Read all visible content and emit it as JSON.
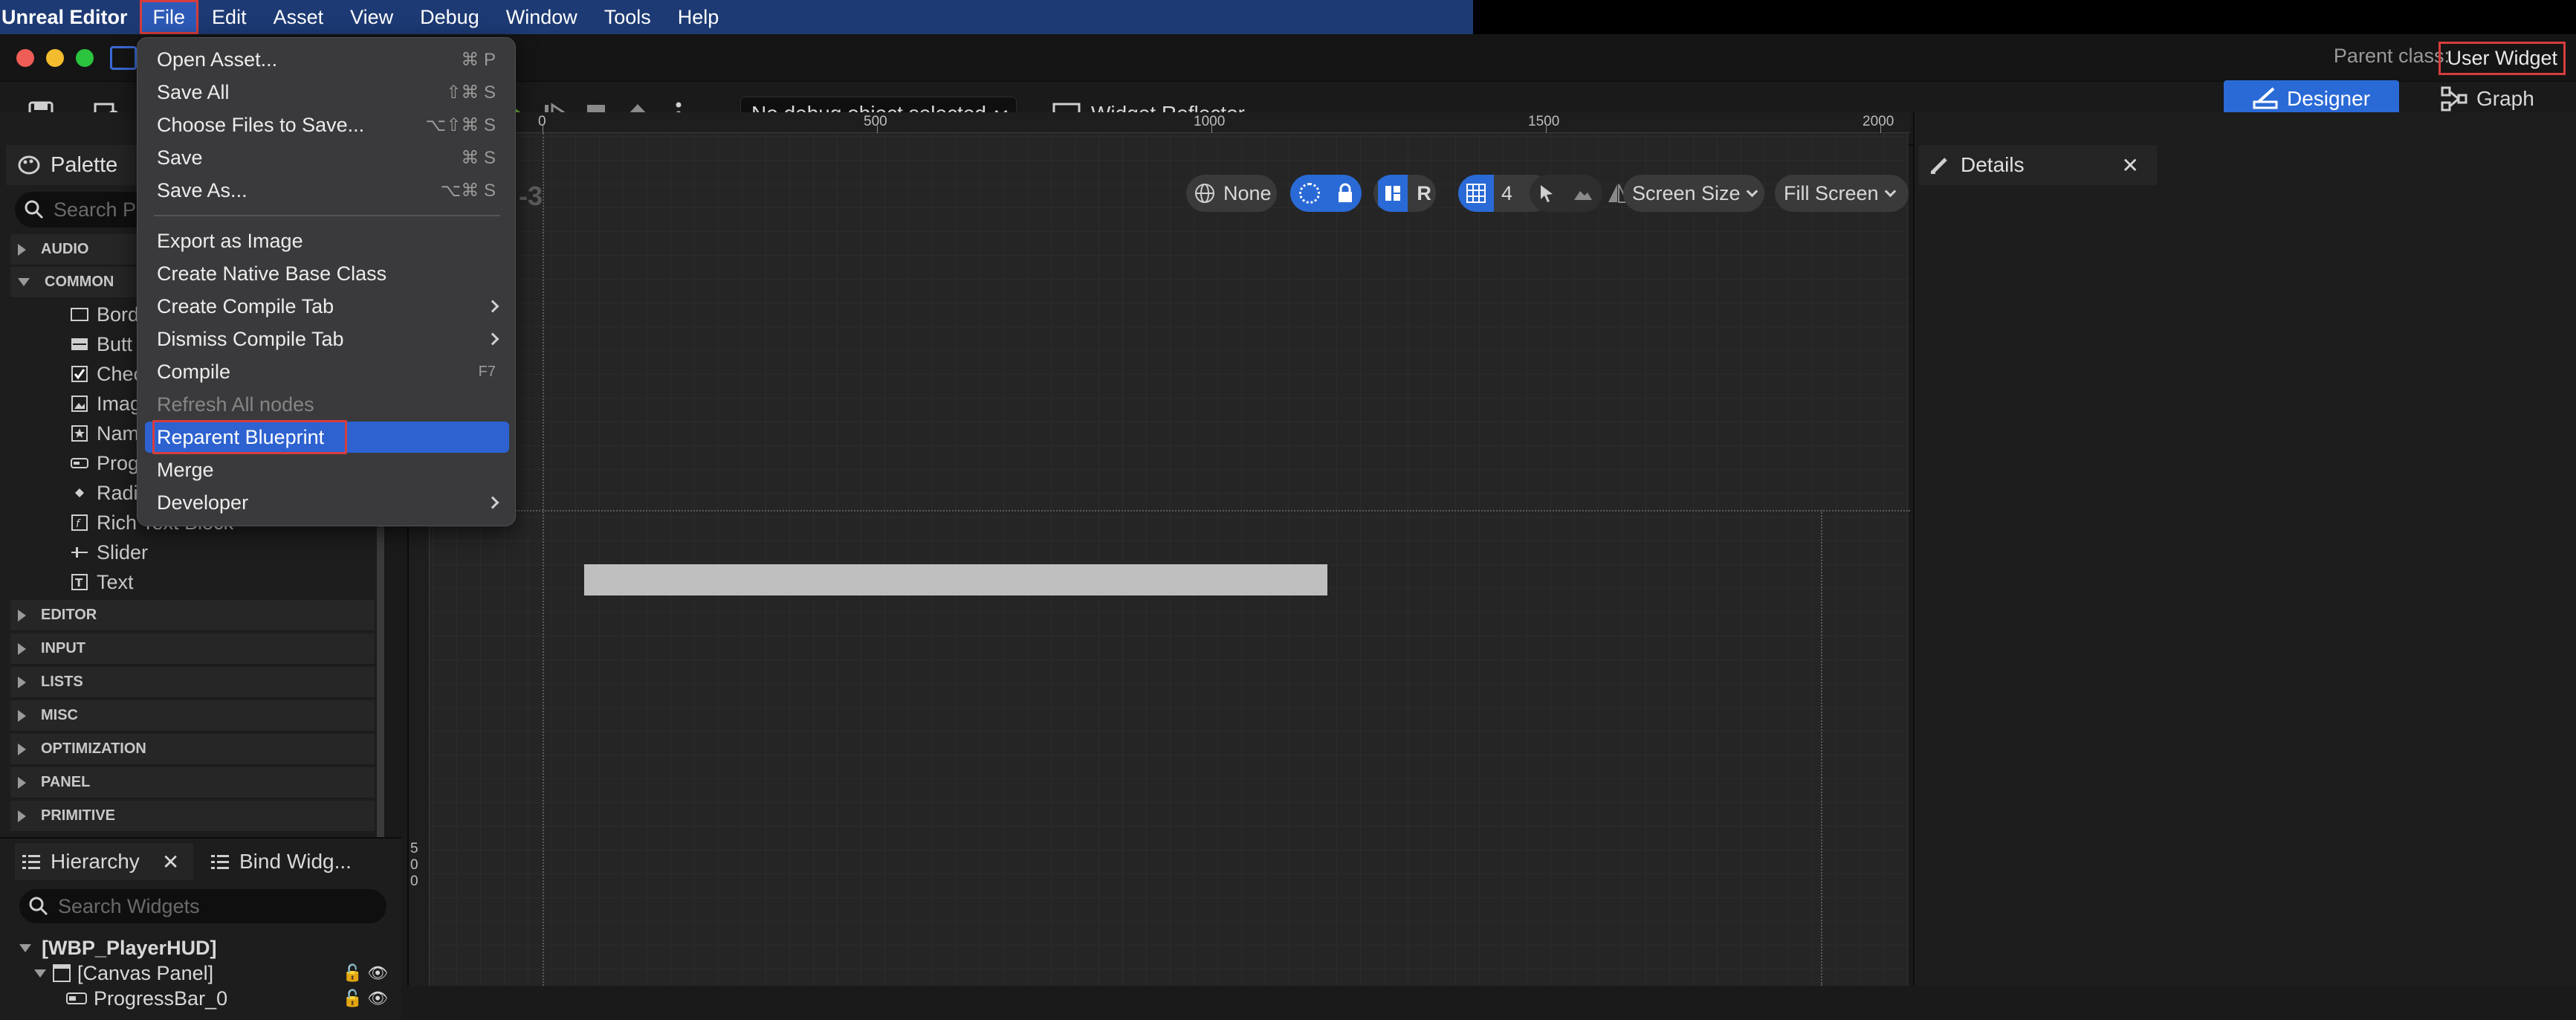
{
  "menubar": {
    "app_name": "Unreal Editor",
    "items": [
      "File",
      "Edit",
      "Asset",
      "View",
      "Debug",
      "Window",
      "Tools",
      "Help"
    ]
  },
  "titlebar": {
    "parent_class_label": "Parent class:",
    "parent_class_value": "User Widget"
  },
  "toolbar": {
    "debug_select": "No debug object selected",
    "widget_reflector": "Widget Reflector",
    "designer": "Designer",
    "graph": "Graph"
  },
  "file_menu": {
    "items": [
      {
        "label": "Open Asset...",
        "shortcut": "⌘ P"
      },
      {
        "label": "Save All",
        "shortcut": "⇧⌘ S"
      },
      {
        "label": "Choose Files to Save...",
        "shortcut": "⌥⇧⌘ S"
      },
      {
        "label": "Save",
        "shortcut": "⌘ S"
      },
      {
        "label": "Save As...",
        "shortcut": "⌥⌘ S"
      },
      {
        "label": "Export as Image",
        "shortcut": ""
      },
      {
        "label": "Create Native Base Class",
        "shortcut": ""
      },
      {
        "label": "Create Compile Tab",
        "shortcut": ""
      },
      {
        "label": "Dismiss Compile Tab",
        "shortcut": ""
      },
      {
        "label": "Compile",
        "shortcut": "F7"
      },
      {
        "label": "Refresh All nodes",
        "shortcut": ""
      },
      {
        "label": "Reparent Blueprint",
        "shortcut": ""
      },
      {
        "label": "Merge",
        "shortcut": ""
      },
      {
        "label": "Developer",
        "shortcut": ""
      }
    ]
  },
  "palette": {
    "title": "Palette",
    "search_placeholder": "Search P",
    "categories_top": [
      "AUDIO",
      "COMMON"
    ],
    "common_items": [
      "Bord",
      "Butt",
      "Chec",
      "Imag",
      "Nam",
      "Prog",
      "Radi",
      "Rich Text Block",
      "Slider",
      "Text"
    ],
    "categories_bottom": [
      "EDITOR",
      "INPUT",
      "LISTS",
      "MISC",
      "OPTIMIZATION",
      "PANEL",
      "PRIMITIVE"
    ]
  },
  "hierarchy": {
    "tab": "Hierarchy",
    "bind_tab": "Bind Widg...",
    "search_placeholder": "Search Widgets",
    "root": "[WBP_PlayerHUD]",
    "canvas": "[Canvas Panel]",
    "child": "ProgressBar_0"
  },
  "designer": {
    "zoom_label": "-3",
    "ruler_top": [
      "0",
      "500",
      "1000",
      "1500",
      "2000"
    ],
    "ruler_left": "500",
    "toolbar": {
      "none": "None",
      "r": "R",
      "grid_snap": "4",
      "screen_size": "Screen Size",
      "fill_screen": "Fill Screen"
    }
  },
  "details": {
    "title": "Details"
  },
  "colors": {
    "accent": "#2a6ad6",
    "highlight_outline": "#d63d3d",
    "menubar": "#1d3a74"
  }
}
